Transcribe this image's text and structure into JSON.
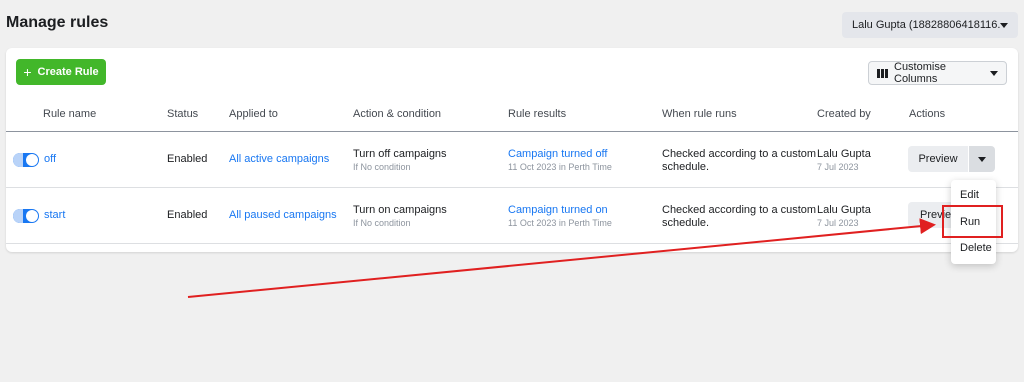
{
  "page": {
    "title": "Manage rules"
  },
  "account": {
    "label": "Lalu Gupta (18828806418116..."
  },
  "toolbar": {
    "create_label": "Create Rule",
    "create_icon": "+",
    "customise_label": "Customise Columns"
  },
  "columns": [
    "Rule name",
    "Status",
    "Applied to",
    "Action & condition",
    "Rule results",
    "When rule runs",
    "Created by",
    "Actions"
  ],
  "rows": [
    {
      "enabled": true,
      "name": "off",
      "status": "Enabled",
      "applied_to": "All active campaigns",
      "action": "Turn off campaigns",
      "condition": "If No condition",
      "result": "Campaign turned off",
      "result_time": "11 Oct 2023 in Perth Time",
      "when_line1": "Checked according to a custom",
      "when_line2": "schedule.",
      "created_by": "Lalu Gupta",
      "created_date": "7 Jul 2023",
      "preview_label": "Preview"
    },
    {
      "enabled": true,
      "name": "start",
      "status": "Enabled",
      "applied_to": "All paused campaigns",
      "action": "Turn on campaigns",
      "condition": "If No condition",
      "result": "Campaign turned on",
      "result_time": "11 Oct 2023 in Perth Time",
      "when_line1": "Checked according to a custom",
      "when_line2": "schedule.",
      "created_by": "Lalu Gupta",
      "created_date": "7 Jul 2023",
      "preview_label": "Previe"
    }
  ],
  "menu": {
    "items": [
      "Edit",
      "Run",
      "Delete"
    ]
  },
  "colors": {
    "accent": "#1877f2",
    "create_green": "#42b72a",
    "annotation_red": "#e02020"
  }
}
